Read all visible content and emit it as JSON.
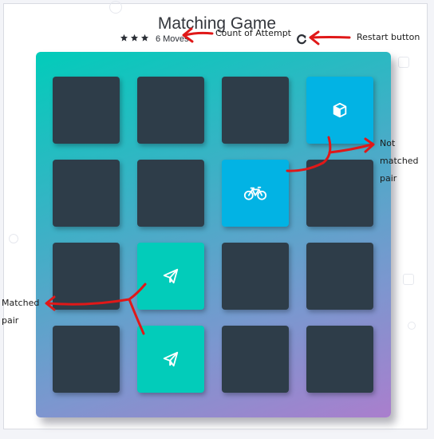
{
  "header": {
    "title": "Matching Game",
    "stars": 3,
    "moves_count": "6",
    "moves_label": "Moves"
  },
  "deck": {
    "rows": 4,
    "cols": 4,
    "cards": [
      {
        "state": "closed",
        "icon": null
      },
      {
        "state": "closed",
        "icon": null
      },
      {
        "state": "closed",
        "icon": null
      },
      {
        "state": "open",
        "icon": "cube-icon"
      },
      {
        "state": "closed",
        "icon": null
      },
      {
        "state": "closed",
        "icon": null
      },
      {
        "state": "open",
        "icon": "bicycle-icon"
      },
      {
        "state": "closed",
        "icon": null
      },
      {
        "state": "closed",
        "icon": null
      },
      {
        "state": "match",
        "icon": "paper-plane-icon"
      },
      {
        "state": "closed",
        "icon": null
      },
      {
        "state": "closed",
        "icon": null
      },
      {
        "state": "closed",
        "icon": null
      },
      {
        "state": "match",
        "icon": "paper-plane-icon"
      },
      {
        "state": "closed",
        "icon": null
      },
      {
        "state": "closed",
        "icon": null
      }
    ]
  },
  "annotations": {
    "count_of_attempt": "Count of Attempt",
    "restart_button": "Restart button",
    "not_matched_pair": [
      "Not",
      "matched",
      "pair"
    ],
    "matched_pair": [
      "Matched",
      "pair"
    ]
  },
  "colors": {
    "card_closed": "#2e3d49",
    "card_open": "#02b3e4",
    "card_match": "#02ccba",
    "annotation_arrow": "#e01818"
  }
}
